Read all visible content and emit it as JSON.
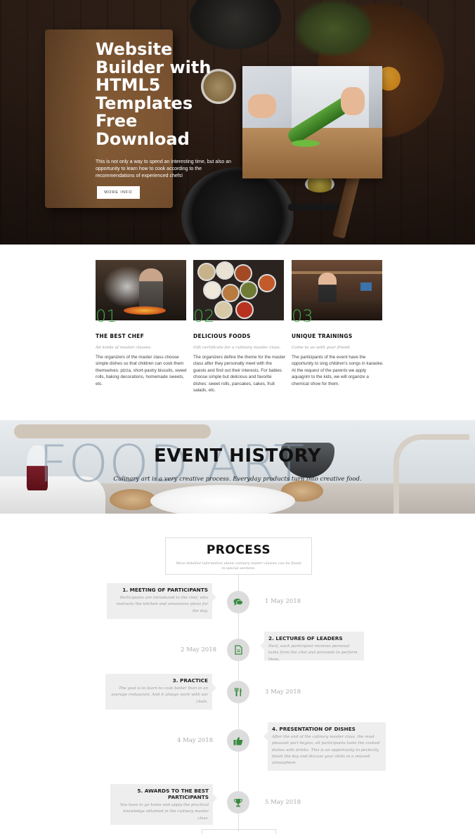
{
  "hero": {
    "title": "Website Builder with HTML5 Templates Free Download",
    "text": "This is not only a way to spend an interesting time, but also an opportunity to learn how to cook according to the recommendations of experienced chefs!",
    "button_label": "MORE INFO"
  },
  "features": [
    {
      "number": "01",
      "title": "THE BEST CHEF",
      "subtitle": "All kinds of master classes.",
      "text": "The organizers of the master class choose simple dishes so that children can cook them themselves: pizza, short-pastry biscuits, sweet rolls, baking decorations, homemade sweets, etc."
    },
    {
      "number": "02",
      "title": "DELICIOUS FOODS",
      "subtitle": "Gift certificate for a culinary master class.",
      "text": "The organizers define the theme for the master class after they personally meet with the guests and find out their interests. For babies choose simple but delicious and favorite dishes: sweet rolls, pancakes, cakes, fruit salads, etc."
    },
    {
      "number": "03",
      "title": "UNIQUE TRAININGS",
      "subtitle": "Come to us with your friend.",
      "text": "The participants of the event have the opportunity to sing children's songs in karaoke. At the request of the parents we apply aquagrim to the kids, we will organize a chemical show for them."
    }
  ],
  "banner": {
    "background_text": "FOOD ART",
    "title": "EVENT HISTORY",
    "subtitle": "Culinary art is a very creative process. Everyday products turn into creative food."
  },
  "process": {
    "title": "PROCESS",
    "subtitle": "More detailed information about culinary master classes can be found in special sections.",
    "steps": [
      {
        "title": "1. MEETING OF PARTICIPANTS",
        "text": "Participants are introduced to the chef, who instructs the kitchen and announces plans for the day.",
        "date": "1 May 2018",
        "icon": "comments-icon"
      },
      {
        "title": "2. LECTURES OF LEADERS",
        "text": "Next, each participant receives personal tasks from the chef and proceeds to perform them.",
        "date": "2 May 2018",
        "icon": "document-icon"
      },
      {
        "title": "3. PRACTICE",
        "text": "The goal is to learn to cook better than in an average restaurant. And it always work with our chefs.",
        "date": "3 May 2018",
        "icon": "cutlery-icon"
      },
      {
        "title": "4. PRESENTATION OF DISHES",
        "text": "After the end of the culinary master class, the most pleasant part begins, all participants taste the cooked dishes with drinks. This is an opportunity to perfectly finish the day and discuss your skills in a relaxed atmosphere.",
        "date": "4 May 2018",
        "icon": "thumbs-up-icon"
      },
      {
        "title": "5. AWARDS TO THE BEST PARTICIPANTS",
        "text": "You have to go home and apply the practical knowledge obtained in the culinary master class.",
        "date": "5 May 2018",
        "icon": "trophy-icon"
      }
    ]
  },
  "colors": {
    "accent": "#3fae4a",
    "icon_color": "#3a8a3e"
  }
}
